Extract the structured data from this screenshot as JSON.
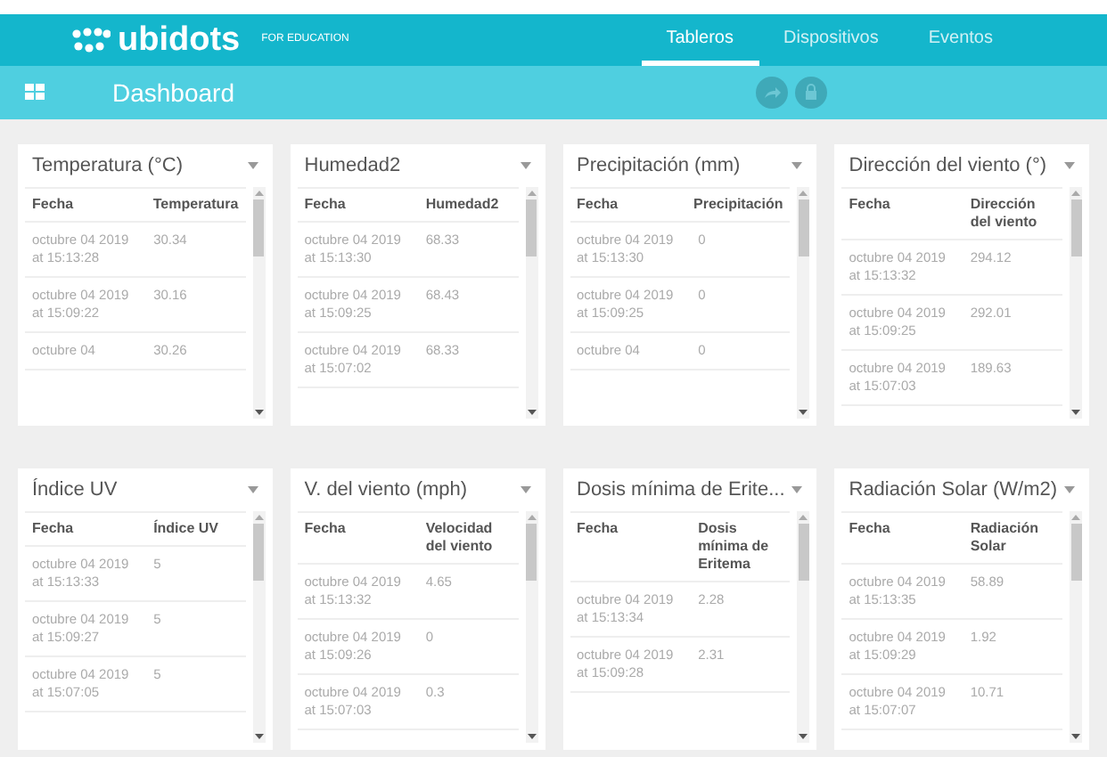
{
  "header": {
    "logo": "ubidots",
    "logo_tag": "FOR EDUCATION",
    "nav": [
      {
        "label": "Tableros",
        "selected": true
      },
      {
        "label": "Dispositivos",
        "selected": false
      },
      {
        "label": "Eventos",
        "selected": false
      }
    ]
  },
  "toolbar": {
    "title": "Dashboard"
  },
  "widgets": [
    {
      "title": "Temperatura (°C)",
      "columns": [
        "Fecha",
        "Temperatura"
      ],
      "rows": [
        {
          "date": "octubre 04 2019 at 15:13:28",
          "value": "30.34"
        },
        {
          "date": "octubre 04 2019 at 15:09:22",
          "value": "30.16"
        },
        {
          "date": "octubre 04",
          "value": "30.26"
        }
      ]
    },
    {
      "title": "Humedad2",
      "columns": [
        "Fecha",
        "Humedad2"
      ],
      "rows": [
        {
          "date": "octubre 04 2019 at 15:13:30",
          "value": "68.33"
        },
        {
          "date": "octubre 04 2019 at 15:09:25",
          "value": "68.43"
        },
        {
          "date": "octubre 04 2019 at 15:07:02",
          "value": "68.33"
        }
      ]
    },
    {
      "title": "Precipitación (mm)",
      "columns": [
        "Fecha",
        "Precipitación"
      ],
      "rows": [
        {
          "date": "octubre 04 2019 at 15:13:30",
          "value": "0"
        },
        {
          "date": "octubre 04 2019 at 15:09:25",
          "value": "0"
        },
        {
          "date": "octubre 04",
          "value": "0"
        }
      ]
    },
    {
      "title": "Dirección del viento (°)",
      "columns": [
        "Fecha",
        "Dirección del viento"
      ],
      "rows": [
        {
          "date": "octubre 04 2019 at 15:13:32",
          "value": "294.12"
        },
        {
          "date": "octubre 04 2019 at 15:09:25",
          "value": "292.01"
        },
        {
          "date": "octubre 04 2019 at 15:07:03",
          "value": "189.63"
        }
      ]
    },
    {
      "title": "Índice UV",
      "columns": [
        "Fecha",
        "Índice UV"
      ],
      "rows": [
        {
          "date": "octubre 04 2019 at 15:13:33",
          "value": "5"
        },
        {
          "date": "octubre 04 2019 at 15:09:27",
          "value": "5"
        },
        {
          "date": "octubre 04 2019 at 15:07:05",
          "value": "5"
        }
      ]
    },
    {
      "title": "V. del viento (mph)",
      "columns": [
        "Fecha",
        "Velocidad del viento"
      ],
      "rows": [
        {
          "date": "octubre 04 2019 at 15:13:32",
          "value": "4.65"
        },
        {
          "date": "octubre 04 2019 at 15:09:26",
          "value": "0"
        },
        {
          "date": "octubre 04 2019 at 15:07:03",
          "value": "0.3"
        }
      ]
    },
    {
      "title": "Dosis mínima de Erite...",
      "columns": [
        "Fecha",
        "Dosis mínima de Eritema"
      ],
      "rows": [
        {
          "date": "octubre 04 2019 at 15:13:34",
          "value": "2.28"
        },
        {
          "date": "octubre 04 2019 at 15:09:28",
          "value": "2.31"
        }
      ]
    },
    {
      "title": "Radiación Solar (W/m2)",
      "columns": [
        "Fecha",
        "Radiación Solar"
      ],
      "rows": [
        {
          "date": "octubre 04 2019 at 15:13:35",
          "value": "58.89"
        },
        {
          "date": "octubre 04 2019 at 15:09:29",
          "value": "1.92"
        },
        {
          "date": "octubre 04 2019 at 15:07:07",
          "value": "10.71"
        }
      ]
    }
  ]
}
